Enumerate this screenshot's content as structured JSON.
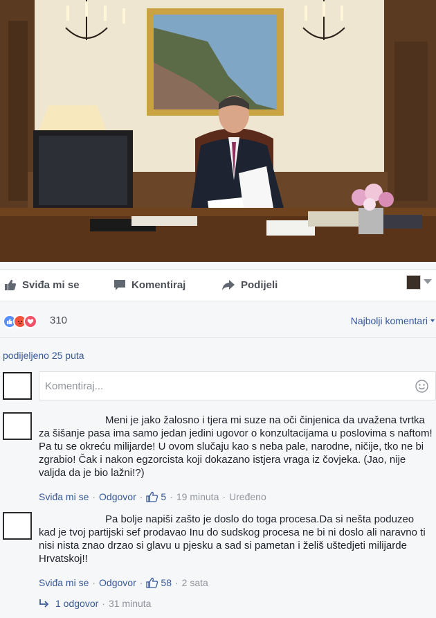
{
  "actions": {
    "like": "Sviđa mi se",
    "comment": "Komentiraj",
    "share": "Podijeli"
  },
  "reactions": {
    "count": "310",
    "sort_label": "Najbolji komentari"
  },
  "shares": "podijeljeno 25 puta",
  "composer": {
    "placeholder": "Komentiraj..."
  },
  "comments": [
    {
      "text": "Meni je jako žalosno i tjera mi suze na oči činjenica da uvažena tvrtka za šišanje pasa ima samo jedan jedini ugovor o konzultacijama u poslovima s naftom! Pa tu se okreću milijarde! U ovom slučaju kao s neba pale, narodne, ničije, tko ne bi zgrabio! Čak i nakon egzorcista koji dokazano istjera vraga iz čovjeka. (Jao, nije valjda da je bio lažni!?)",
      "like_label": "Sviđa mi se",
      "reply_label": "Odgovor",
      "likes": "5",
      "time": "19 minuta",
      "edited": "Uređeno"
    },
    {
      "text": "Pa bolje napiši zašto je doslo do toga procesa.Da si nešta poduzeo kad je tvoj partijski sef prodavao Inu do sudskog procesa ne bi ni doslo ali naravno ti nisi nista znao drzao si glavu u pjesku a sad si pametan i želiš uštedjeti milijarde Hrvatskoj!!",
      "like_label": "Sviđa mi se",
      "reply_label": "Odgovor",
      "likes": "58",
      "time": "2 sata"
    }
  ],
  "replies": {
    "label": "1 odgovor",
    "time": "31 minuta"
  },
  "colors": {
    "link": "#365899",
    "meta": "#90949c",
    "action": "#4b4f56"
  }
}
